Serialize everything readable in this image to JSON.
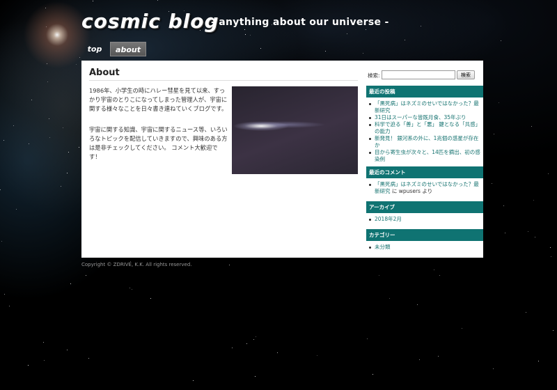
{
  "header": {
    "logo": "cosmic blog",
    "tagline": "- anything about our universe -"
  },
  "nav": {
    "items": [
      {
        "label": "top"
      },
      {
        "label": "about"
      }
    ]
  },
  "main": {
    "title": "About",
    "paragraphs": [
      "1986年、小学生の時にハレー彗星を見て以来、すっかり宇宙のとりこになってしまった管理人が、宇宙に関する様々なことを日々書き連ねていくブログです。",
      "宇宙に関する知識、宇宙に関するニュース等、いろいろなトピックを配信していきますので、興味のある方は是非チェックしてください。 コメント大歓迎です！"
    ]
  },
  "sidebar": {
    "search": {
      "label": "検索:",
      "placeholder": "",
      "value": "",
      "button": "検索"
    },
    "recent_posts": {
      "heading": "最近の投稿",
      "items": [
        "「黒死病」はネズミのせいではなかった？最新研究",
        "31日はスーパーな皆既月食、35年ぶり",
        "科学で迫る「善」と「悪」 鍵となる「共感」の能力",
        "新発見！ 銀河系の外に、1兆個の惑星が存在か",
        "目から寄生虫が次々と、14匹を摘出、初の感染例"
      ]
    },
    "recent_comments": {
      "heading": "最近のコメント",
      "link": "「黒死病」はネズミのせいではなかった？最新研究",
      "link_cont": "研究",
      "suffix": "に wpusers より"
    },
    "archives": {
      "heading": "アーカイブ",
      "items": [
        "2018年2月"
      ]
    },
    "categories": {
      "heading": "カテゴリー",
      "items": [
        "未分類"
      ]
    }
  },
  "footer": {
    "copyright": "Copyright © ZDRIVE, K.K. All rights reserved."
  }
}
